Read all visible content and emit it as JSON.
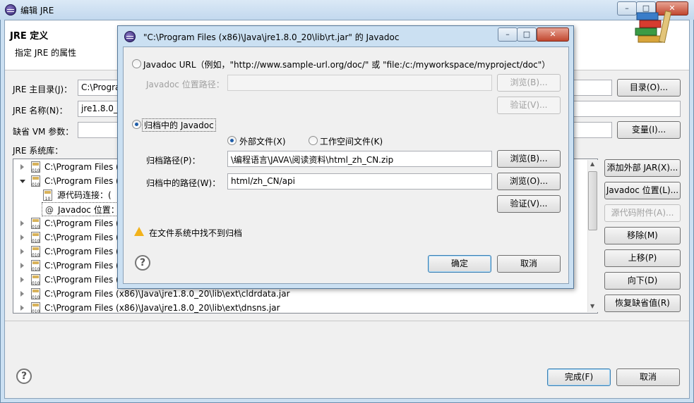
{
  "window": {
    "title": "编辑 JRE",
    "minimize": "–",
    "maximize": "□",
    "close": "✕"
  },
  "header": {
    "title": "JRE 定义",
    "subtitle": "指定 JRE 的属性"
  },
  "form": {
    "home_label": "JRE 主目录(J)：",
    "home_value": "C:\\Progra",
    "name_label": "JRE 名称(N)：",
    "name_value": "jre1.8.0_2",
    "vmargs_label": "缺省 VM 参数：",
    "vmargs_value": "",
    "libs_label": "JRE 系统库：",
    "dir_button": "目录(O)...",
    "var_button": "变量(I)..."
  },
  "library": {
    "rows": [
      {
        "text": "C:\\Program Files (",
        "expanded": false,
        "icon": "jar-icon"
      },
      {
        "text": "C:\\Program Files (",
        "expanded": true,
        "icon": "jar-icon"
      },
      {
        "text": "源代码连接：(",
        "child": true,
        "icon": "source-attachment-icon"
      },
      {
        "text": "Javadoc 位置：",
        "child": true,
        "icon": "javadoc-icon"
      },
      {
        "text": "C:\\Program Files (",
        "expanded": false,
        "icon": "jar-icon"
      },
      {
        "text": "C:\\Program Files (",
        "expanded": false,
        "icon": "jar-icon"
      },
      {
        "text": "C:\\Program Files (",
        "expanded": false,
        "icon": "jar-icon"
      },
      {
        "text": "C:\\Program Files (",
        "expanded": false,
        "icon": "jar-icon"
      },
      {
        "text": "C:\\Program Files (",
        "expanded": false,
        "icon": "jar-icon"
      },
      {
        "text": "C:\\Program Files (x86)\\Java\\jre1.8.0_20\\lib\\ext\\cldrdata.jar",
        "expanded": false,
        "icon": "jar-icon"
      },
      {
        "text": "C:\\Program Files (x86)\\Java\\jre1.8.0_20\\lib\\ext\\dnsns.jar",
        "expanded": false,
        "icon": "jar-icon"
      }
    ],
    "buttons": {
      "add_external_jar": "添加外部 JAR(X)...",
      "javadoc_location": "Javadoc 位置(L)...",
      "source_attachment": "源代码附件(A)...",
      "remove": "移除(M)",
      "move_up": "上移(P)",
      "move_down": "向下(D)",
      "restore_default": "恢复缺省值(R)"
    }
  },
  "footer": {
    "finish": "完成(F)",
    "cancel": "取消"
  },
  "dialog": {
    "title": "\"C:\\Program Files (x86)\\Java\\jre1.8.0_20\\lib\\rt.jar\" 的 Javadoc",
    "url_option": "Javadoc URL（例如，\"http://www.sample-url.org/doc/\" 或 \"file:/c:/myworkspace/myproject/doc\"）",
    "url_path_label": "Javadoc 位置路径：",
    "url_path_value": "",
    "url_browse": "浏览(B)...",
    "url_validate": "验证(V)...",
    "archive_option": "归档中的 Javadoc",
    "external_file": "外部文件(X)",
    "workspace_file": "工作空间文件(K)",
    "archive_path_label": "归档路径(P)：",
    "archive_path_value": "\\编程语言\\JAVA\\阅读资料\\html_zh_CN.zip",
    "archive_browse": "浏览(B)...",
    "path_in_archive_label": "归档中的路径(W)：",
    "path_in_archive_value": "html/zh_CN/api",
    "path_browse": "浏览(O)...",
    "archive_validate": "验证(V)...",
    "warning": "在文件系统中找不到归档",
    "ok": "确定",
    "cancel": "取消"
  }
}
